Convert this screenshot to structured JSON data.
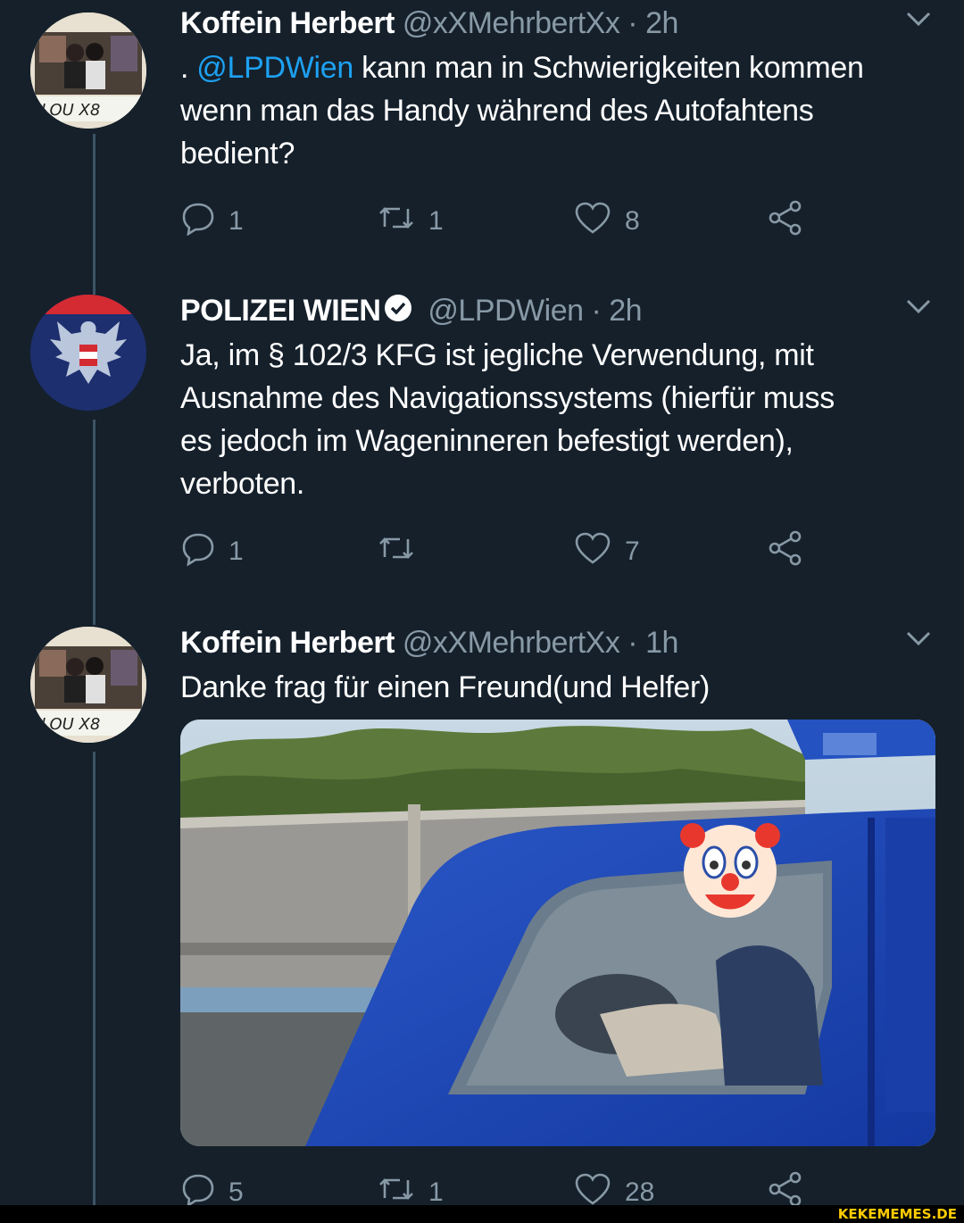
{
  "tweets": [
    {
      "display_name": "Koffein Herbert",
      "handle": "@xXMehrbertXx",
      "separator": "·",
      "time": "2h",
      "text_prefix": ". ",
      "mention": "@LPDWien",
      "text_line1_rest": " kann man in Schwierigkeiten kommen",
      "text_line2": "wenn man das Handy während des Autofahtens",
      "text_line3": "bedient?",
      "replies": "1",
      "retweets": "1",
      "likes": "8"
    },
    {
      "display_name": "POLIZEI WIEN",
      "handle": "@LPDWien",
      "separator": "·",
      "time": "2h",
      "text_line1": "Ja, im § 102/3 KFG ist jegliche Verwendung, mit",
      "text_line2": "Ausnahme des Navigationssystems (hierfür muss",
      "text_line3": "es jedoch im Wageninneren befestigt werden),",
      "text_line4": "verboten.",
      "replies": "1",
      "retweets": "",
      "likes": "7"
    },
    {
      "display_name": "Koffein Herbert",
      "handle": "@xXMehrbertXx",
      "separator": "·",
      "time": "1h",
      "text_line1": "Danke frag für einen Freund(und Helfer)",
      "replies": "5",
      "retweets": "1",
      "likes": "28"
    }
  ],
  "icons": {
    "reply": "reply-icon",
    "retweet": "retweet-icon",
    "like": "heart-icon",
    "share": "share-icon",
    "more": "chevron-down-icon",
    "verified": "verified-badge-icon",
    "overlay": "clown-face-emoji"
  },
  "colors": {
    "background": "#15202b",
    "mention": "#1da1f2",
    "secondary_text": "#8899a6",
    "watermark": "#ffcc00"
  },
  "watermark": "KEKEMEMES.DE"
}
